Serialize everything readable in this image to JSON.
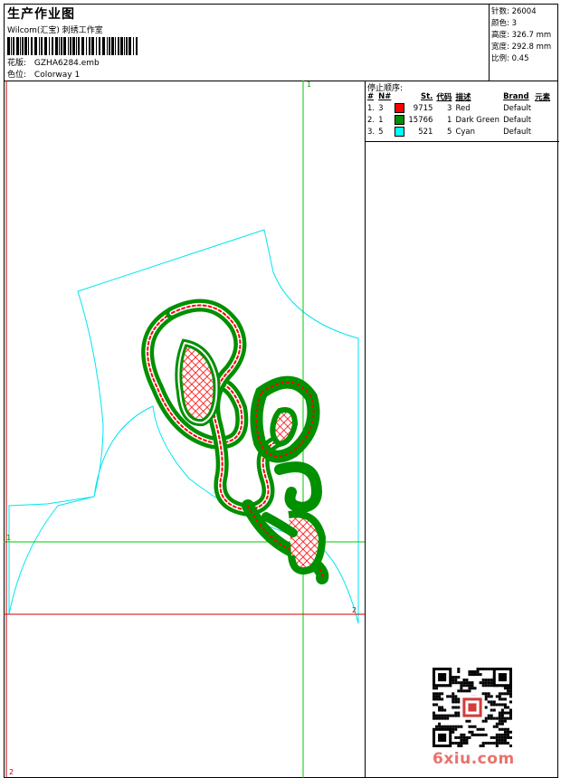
{
  "header": {
    "title": "生产作业图",
    "company": "Wilcom(汇宝) 刺绣工作室",
    "pattern_label": "花版:",
    "pattern_value": "GZHA6284.emb",
    "colorway_label": "色位:",
    "colorway_value": "Colorway 1"
  },
  "stats": {
    "stitches": "针数: 26004",
    "colors": "颜色: 3",
    "height": "高度: 326.7 mm",
    "width": "宽度: 292.8 mm",
    "scale": "比例: 0.45"
  },
  "stop_sequence": {
    "title": "停止顺序:",
    "columns": [
      "#",
      "N#",
      "St.",
      "代码",
      "描述",
      "Brand",
      "元素"
    ],
    "rows": [
      {
        "idx": "1.",
        "n": "3",
        "color": "#ff0000",
        "stitches": "9715",
        "code": "3",
        "desc": "Red",
        "brand": "Default"
      },
      {
        "idx": "2.",
        "n": "1",
        "color": "#009000",
        "stitches": "15766",
        "code": "1",
        "desc": "Dark Green",
        "brand": "Default"
      },
      {
        "idx": "3.",
        "n": "5",
        "color": "#00ffff",
        "stitches": "521",
        "code": "5",
        "desc": "Cyan",
        "brand": "Default"
      }
    ]
  },
  "guides": {
    "v1": "1",
    "h1": "1",
    "h2": "2",
    "v2": "2"
  },
  "watermark": "6xiu.com",
  "colors": {
    "red": "#ff0000",
    "green": "#009000",
    "cyan": "#00e5ee",
    "guide_green": "#00c800",
    "guide_red": "#d00000"
  }
}
